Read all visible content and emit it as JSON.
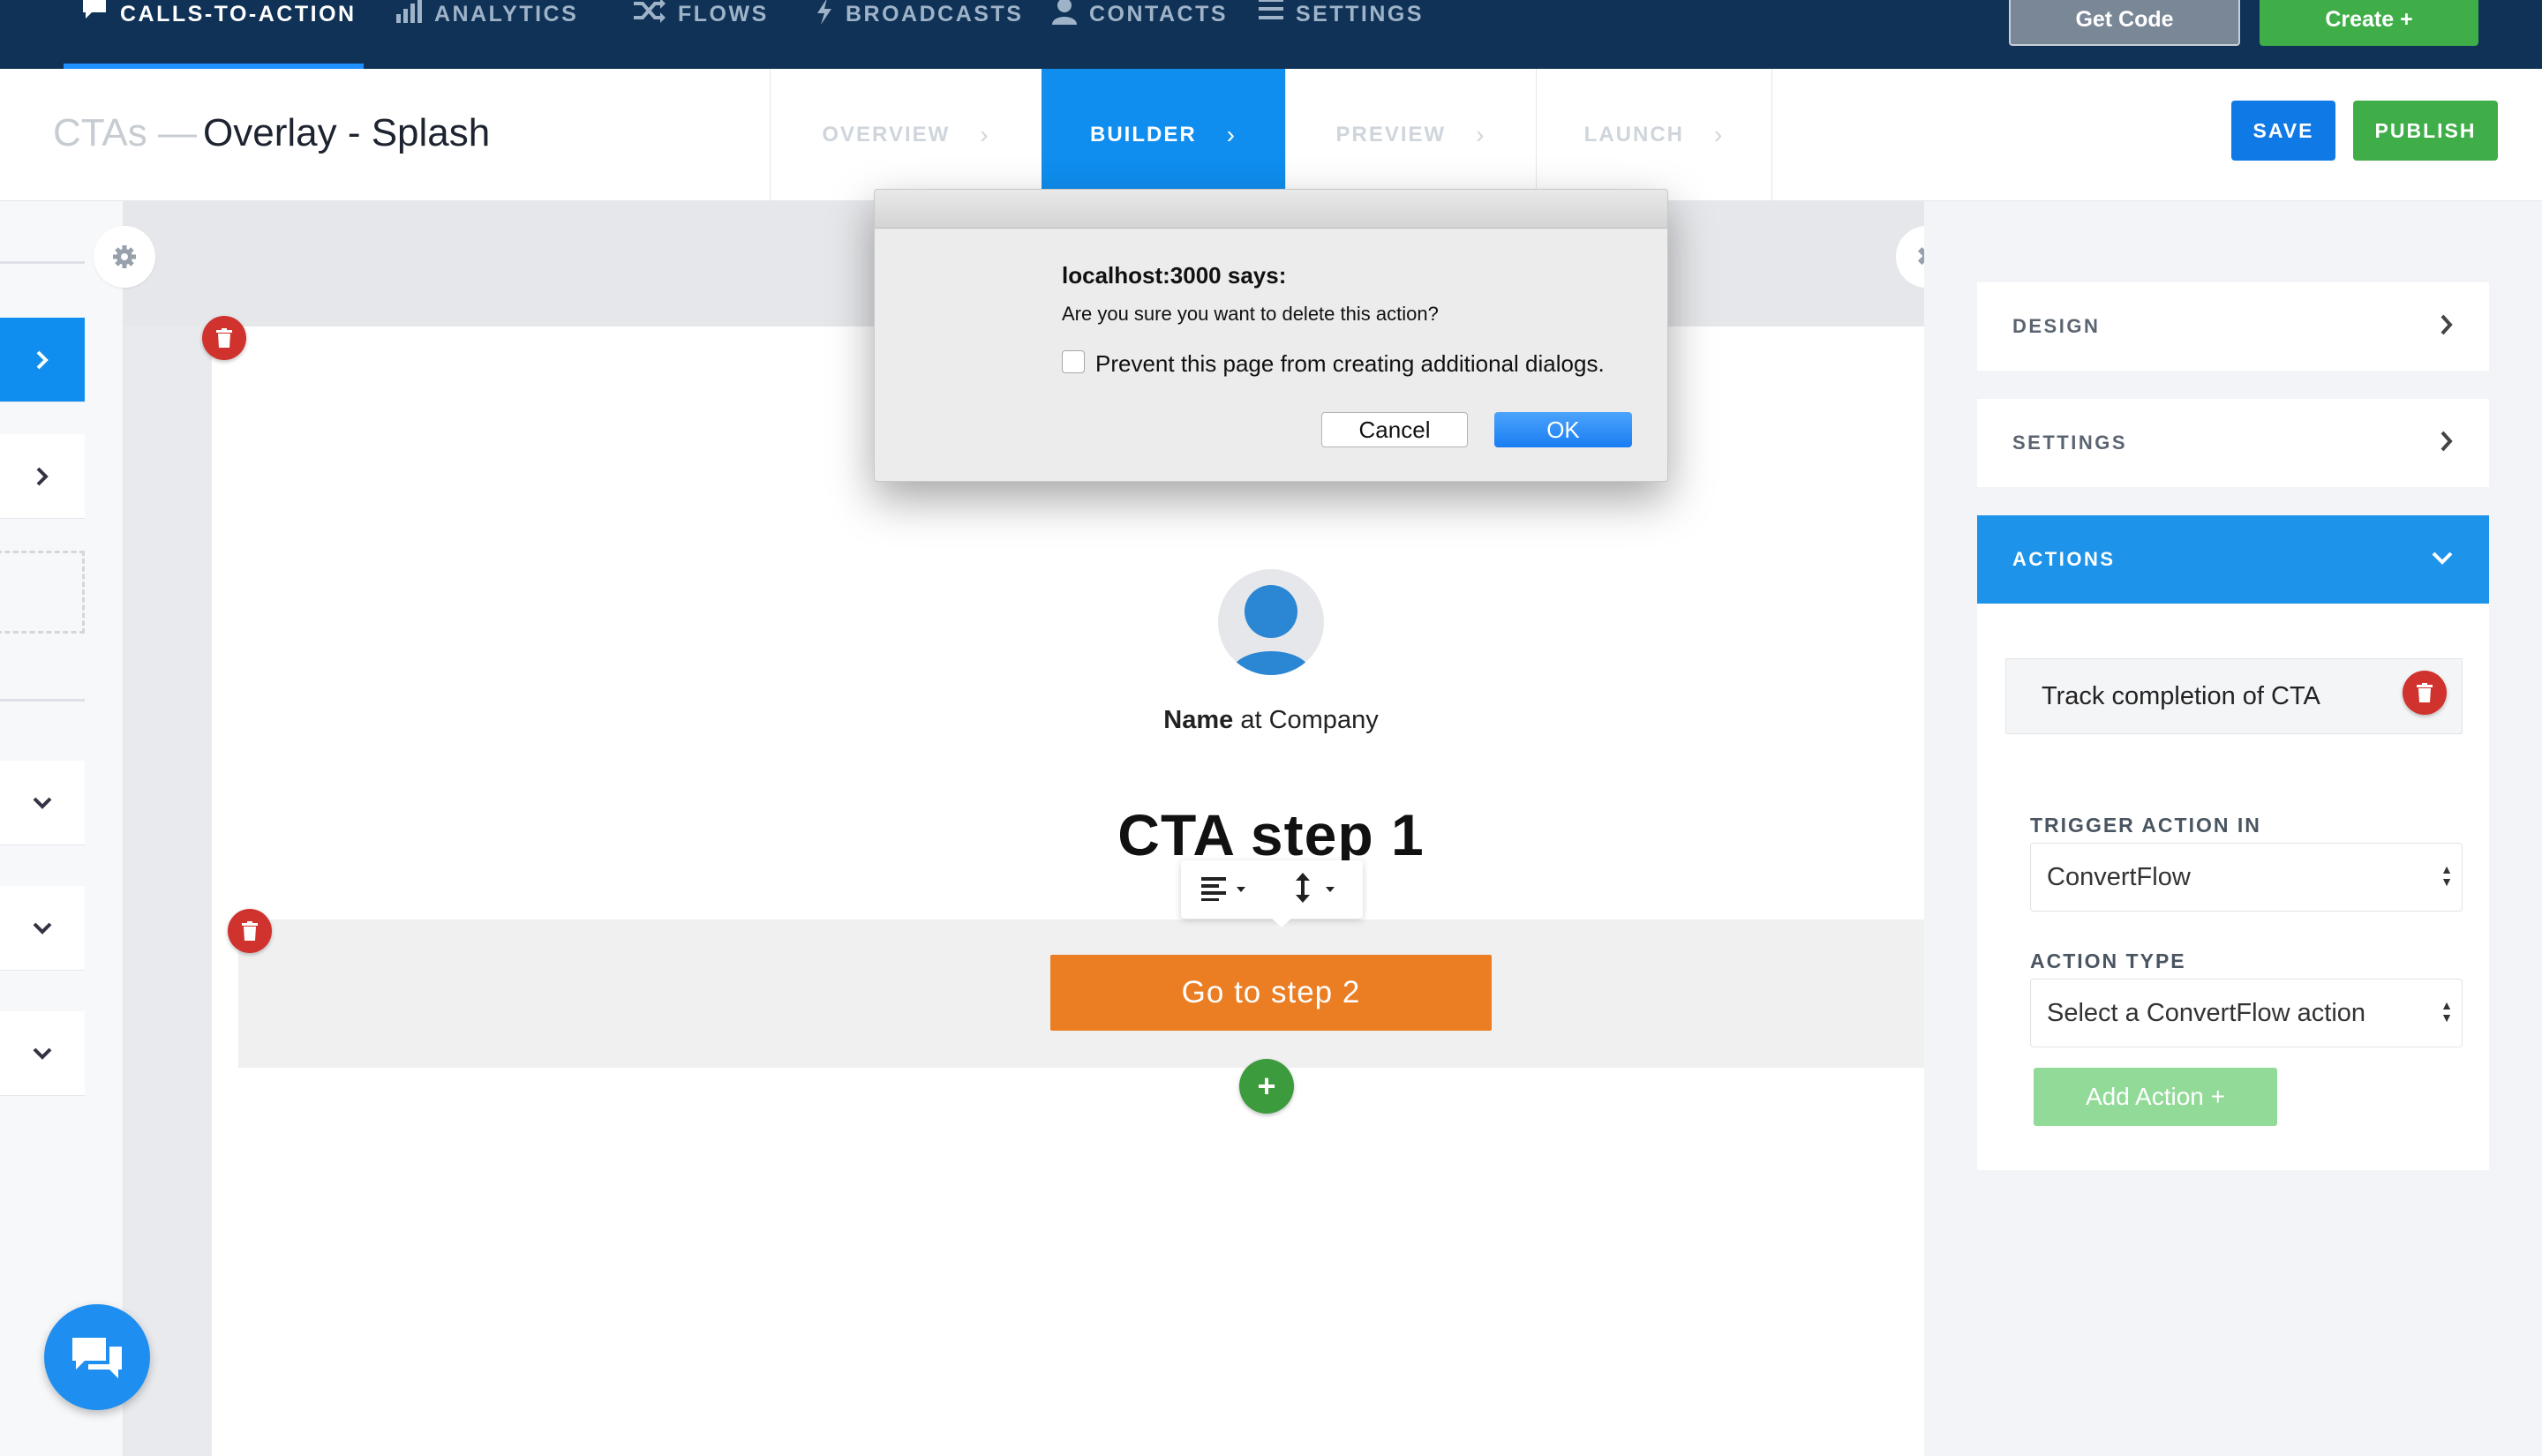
{
  "nav": {
    "items": [
      {
        "label": "CALLS-TO-ACTION",
        "icon": "speech-bubble-icon"
      },
      {
        "label": "ANALYTICS",
        "icon": "bar-chart-icon"
      },
      {
        "label": "FLOWS",
        "icon": "shuffle-icon"
      },
      {
        "label": "BROADCASTS",
        "icon": "lightning-icon"
      },
      {
        "label": "CONTACTS",
        "icon": "person-icon"
      },
      {
        "label": "SETTINGS",
        "icon": "menu-icon"
      }
    ],
    "get_code": "Get Code",
    "create": "Create +"
  },
  "header": {
    "crumb_root": "CTAs —",
    "title": "Overlay - Splash",
    "steps": [
      "OVERVIEW",
      "BUILDER",
      "PREVIEW",
      "LAUNCH"
    ],
    "active_step": "BUILDER",
    "save": "SAVE",
    "publish": "PUBLISH"
  },
  "canvas": {
    "name_bold": "Name",
    "name_rest": " at Company",
    "heading": "CTA step 1",
    "button": "Go to step 2",
    "add": "+"
  },
  "panel": {
    "design": "DESIGN",
    "settings": "SETTINGS",
    "actions": "ACTIONS",
    "track": "Track completion of CTA",
    "trigger_label": "TRIGGER ACTION IN",
    "trigger_value": "ConvertFlow",
    "type_label": "ACTION TYPE",
    "type_value": "Select a ConvertFlow action",
    "add_action": "Add Action +"
  },
  "dialog": {
    "title": "localhost:3000 says:",
    "message": "Are you sure you want to delete this action?",
    "checkbox_label": "Prevent this page from creating additional dialogs.",
    "cancel": "Cancel",
    "ok": "OK"
  },
  "colors": {
    "nav_bg": "#0f3256",
    "accent_blue": "#0f8eef",
    "green": "#3fae49",
    "orange": "#eb7d23",
    "danger": "#d0322d"
  }
}
